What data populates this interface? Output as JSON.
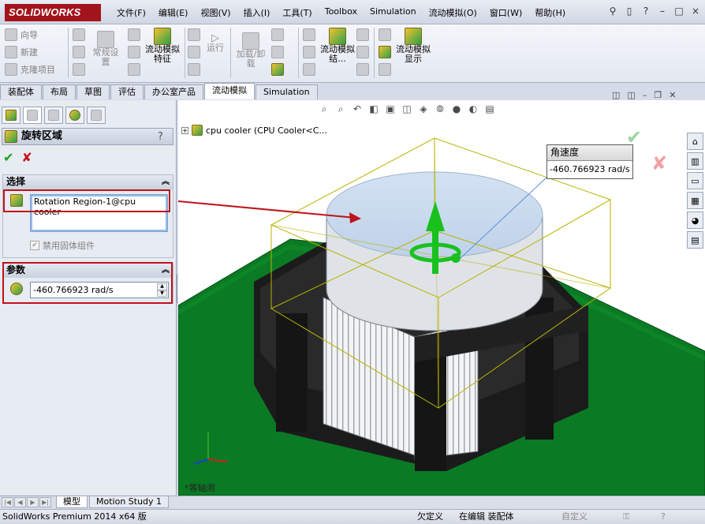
{
  "app": {
    "logo": "SOLIDWORKS",
    "menu": [
      "文件(F)",
      "编辑(E)",
      "视图(V)",
      "插入(I)",
      "工具(T)",
      "Toolbox",
      "Simulation",
      "流动模拟(O)",
      "窗口(W)",
      "帮助(H)"
    ],
    "pin_icon": "pushpin-icon",
    "window_controls": [
      "?",
      "–",
      "□",
      "×"
    ]
  },
  "command_manager": {
    "col1": [
      "向导",
      "新建",
      "克隆项目"
    ],
    "general_settings": "常规设置",
    "flow_feature": "流动模拟特征",
    "run": "运行",
    "load_unload": "加载/卸载",
    "flow_results": "流动模拟结...",
    "flow_display": "流动模拟显示"
  },
  "command_tabs": [
    "装配体",
    "布局",
    "草图",
    "评估",
    "办公室产品",
    "流动模拟",
    "Simulation"
  ],
  "active_command_tab": "流动模拟",
  "property_manager": {
    "title": "旋转区域",
    "help": "?",
    "selection": {
      "header": "选择",
      "item": "Rotation Region-1@cpu cooler",
      "checkbox_label": "禁用固体组件",
      "checkbox_checked": true
    },
    "parameters": {
      "header": "参数",
      "value": "-460.766923 rad/s"
    }
  },
  "graphics": {
    "tree_root": "cpu cooler  (CPU Cooler<C...",
    "tooltip_title": "角速度",
    "tooltip_value": "-460.766923 rad/s",
    "axis_label": "*等轴测"
  },
  "bottom_tabs": [
    "模型",
    "Motion Study 1"
  ],
  "active_bottom_tab": "模型",
  "statusbar": {
    "product": "SolidWorks Premium 2014 x64 版",
    "state": "欠定义",
    "mode": "在编辑 装配体",
    "custom": "自定义",
    "help": "?"
  },
  "colors": {
    "brand": "#a3131b",
    "highlight": "#c0121a",
    "pcb": "#0b7a24",
    "cooler": "#1c1c1c",
    "region": "#cfe0f2"
  }
}
